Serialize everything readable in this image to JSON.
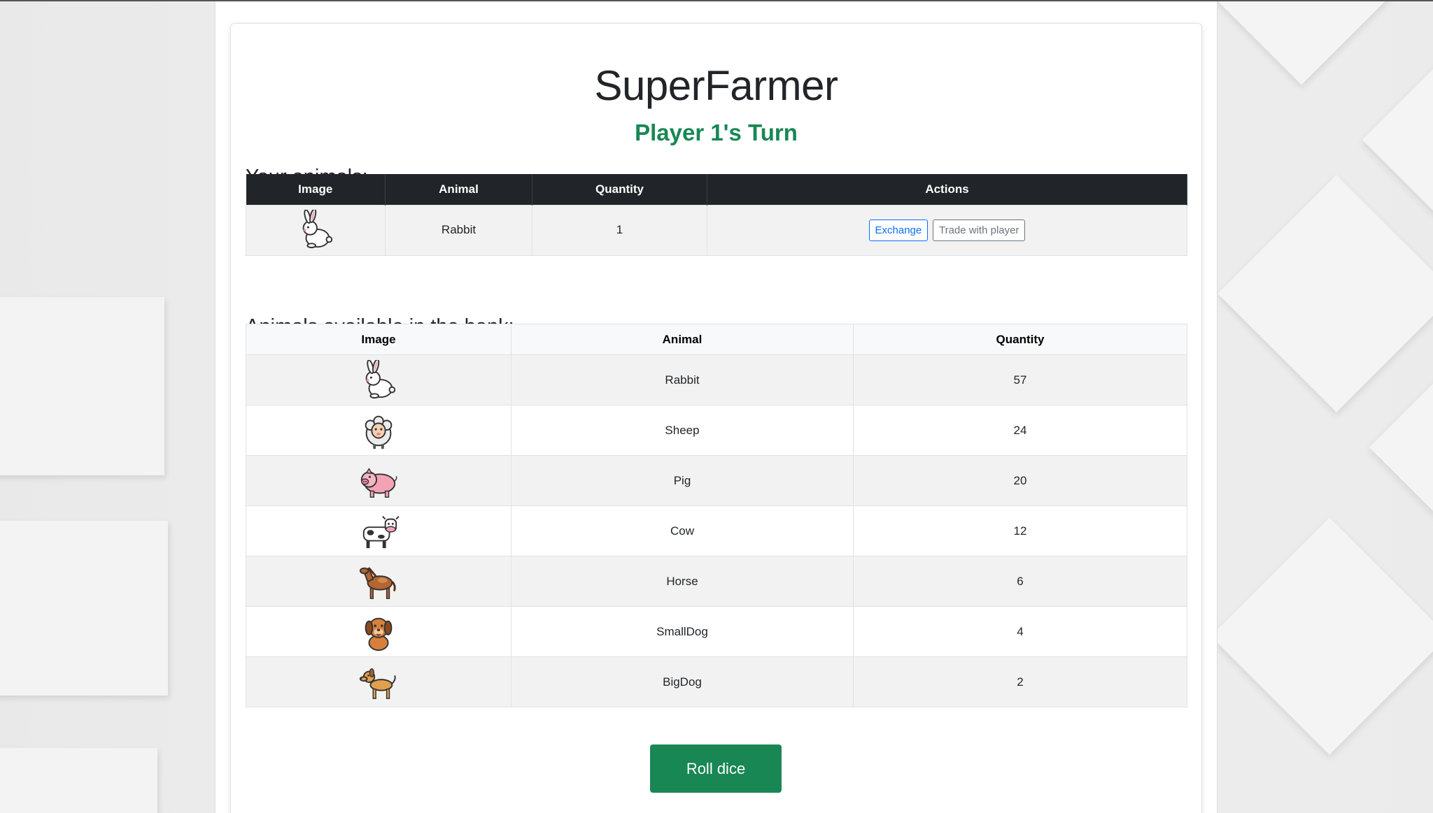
{
  "app": {
    "title": "SuperFarmer",
    "turn_text": "Player 1's Turn",
    "accent_color": "#198754"
  },
  "your_animals": {
    "heading": "Your animals:",
    "columns": [
      "Image",
      "Animal",
      "Quantity",
      "Actions"
    ],
    "rows": [
      {
        "icon": "rabbit-icon",
        "animal": "Rabbit",
        "quantity": "1"
      }
    ],
    "actions": {
      "exchange_label": "Exchange",
      "trade_label": "Trade with player"
    }
  },
  "bank": {
    "heading": "Animals available in the bank:",
    "columns": [
      "Image",
      "Animal",
      "Quantity"
    ],
    "rows": [
      {
        "icon": "rabbit-icon",
        "animal": "Rabbit",
        "quantity": "57"
      },
      {
        "icon": "sheep-icon",
        "animal": "Sheep",
        "quantity": "24"
      },
      {
        "icon": "pig-icon",
        "animal": "Pig",
        "quantity": "20"
      },
      {
        "icon": "cow-icon",
        "animal": "Cow",
        "quantity": "12"
      },
      {
        "icon": "horse-icon",
        "animal": "Horse",
        "quantity": "6"
      },
      {
        "icon": "small-dog-icon",
        "animal": "SmallDog",
        "quantity": "4"
      },
      {
        "icon": "big-dog-icon",
        "animal": "BigDog",
        "quantity": "2"
      }
    ]
  },
  "controls": {
    "roll_label": "Roll dice"
  }
}
